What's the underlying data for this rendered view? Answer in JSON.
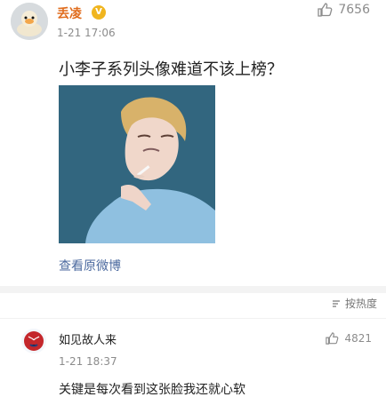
{
  "post": {
    "username": "丢凌",
    "like_count": "7656",
    "timestamp": "1-21 17:06",
    "text": "小李子系列头像难道不该上榜？",
    "view_original": "查看原微博"
  },
  "comments_header": {
    "sort_label": "按热度"
  },
  "comment": {
    "username": "如见故人来",
    "like_count": "4821",
    "timestamp": "1-21 18:37",
    "text": "关键是每次看到这张脸我还就心软"
  },
  "colors": {
    "link": "#4c6a9f",
    "username": "#e06c1d",
    "muted": "#8c8c8c",
    "badge": "#f0b51f"
  }
}
